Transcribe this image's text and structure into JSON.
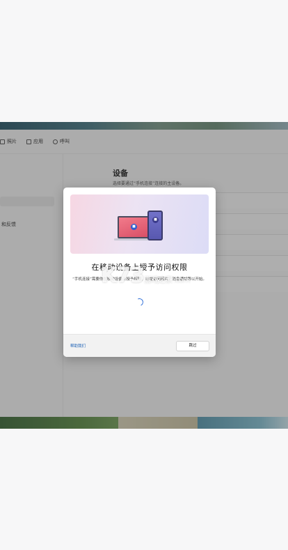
{
  "toolbar": {
    "items": [
      {
        "label": "照片",
        "icon": "image-icon"
      },
      {
        "label": "应用",
        "icon": "grid-icon"
      },
      {
        "label": "呼叫",
        "icon": "phone-icon"
      }
    ]
  },
  "sidebar": {
    "items": [
      {
        "label": "",
        "selected": false
      },
      {
        "label": "",
        "selected": true
      },
      {
        "label": "",
        "selected": false
      },
      {
        "label": "和反馈",
        "selected": false
      }
    ]
  },
  "settings": {
    "title": "设备",
    "subtitle": "选择要通过“手机连接”连接的主设备。"
  },
  "dialog": {
    "title": "在移动设备上授予访问权限",
    "body": "“手机连接”需要你在移动设备上授予权限，以便访问照片、消息通知等以开始。",
    "help_link": "帮助我们",
    "skip_button": "跳过"
  },
  "watermark": {
    "text": "K73",
    "sub": "游戏之家 .com"
  },
  "colors": {
    "accent": "#2a6bd6",
    "dialog_bg": "#ffffff",
    "link": "#1a5fb4"
  }
}
